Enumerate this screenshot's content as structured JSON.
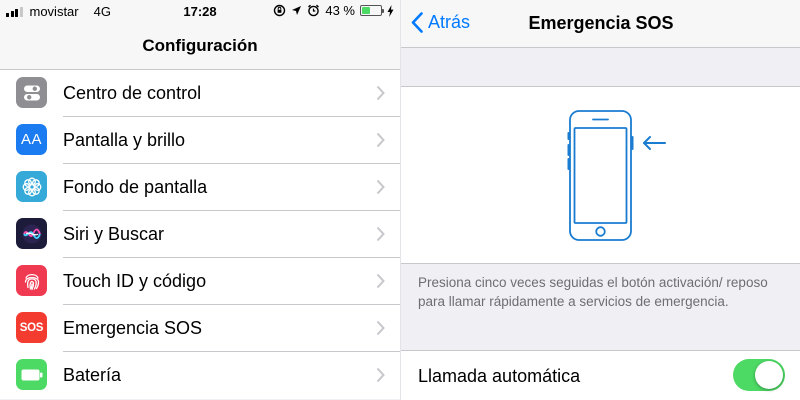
{
  "status_bar": {
    "carrier": "movistar",
    "network": "4G",
    "time": "17:28",
    "battery_percent": "43 %",
    "battery_level": 0.43
  },
  "settings": {
    "title": "Configuración",
    "items": [
      {
        "label": "Centro de control",
        "icon": "toggle-switches-icon",
        "color": "#8e8e93"
      },
      {
        "label": "Pantalla y brillo",
        "icon": "text-size-icon",
        "color": "#1a7cf0",
        "icon_text": "AA"
      },
      {
        "label": "Fondo de pantalla",
        "icon": "flower-icon",
        "color": "#35a9d8"
      },
      {
        "label": "Siri y Buscar",
        "icon": "siri-icon",
        "color": "#1c1c3a"
      },
      {
        "label": "Touch ID y código",
        "icon": "fingerprint-icon",
        "color": "#f03a52"
      },
      {
        "label": "Emergencia SOS",
        "icon": "sos-icon",
        "color": "#f33b30",
        "icon_text": "SOS"
      },
      {
        "label": "Batería",
        "icon": "battery-icon",
        "color": "#4cd964"
      }
    ]
  },
  "sos": {
    "back_label": "Atrás",
    "title": "Emergencia SOS",
    "instructions": "Presiona cinco veces seguidas el botón activación/ reposo para llamar rápidamente a servicios de emergencia.",
    "auto_call_label": "Llamada automática",
    "auto_call_enabled": true
  },
  "colors": {
    "accent": "#007aff",
    "toggle_on": "#4cd964",
    "illustration": "#1a7cd0"
  }
}
